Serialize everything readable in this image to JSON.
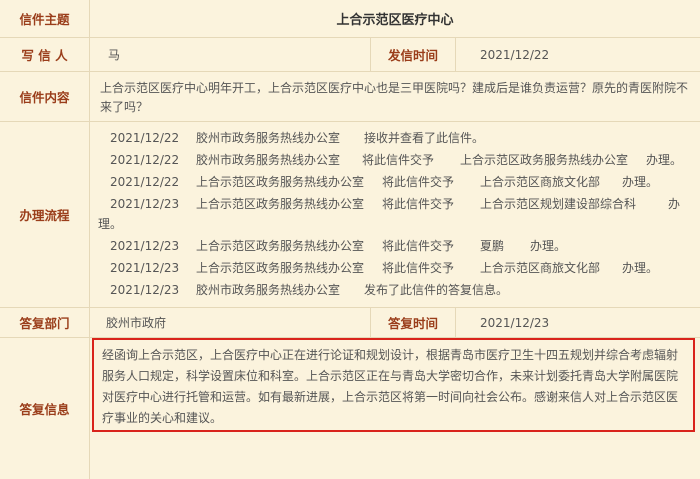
{
  "subject": {
    "label": "信件主题",
    "value": "上合示范区医疗中心"
  },
  "writer": {
    "label": "写 信 人",
    "value": "马",
    "time_label": "发信时间",
    "time_value": "2021/12/22"
  },
  "content": {
    "label": "信件内容",
    "value": "上合示范区医疗中心明年开工，上合示范区医疗中心也是三甲医院吗？建成后是谁负责运营？原先的青医附院不来了吗？"
  },
  "process": {
    "label": "办理流程",
    "steps": [
      {
        "date": "2021/12/22",
        "office": "胶州市政务服务热线办公室",
        "action": "接收并查看了此信件。",
        "target": "",
        "tail": ""
      },
      {
        "date": "2021/12/22",
        "office": "胶州市政务服务热线办公室",
        "action": "将此信件交予",
        "target": "上合示范区政务服务热线办公室",
        "tail": "办理。"
      },
      {
        "date": "2021/12/22",
        "office": "上合示范区政务服务热线办公室",
        "action": "将此信件交予",
        "target": "上合示范区商旅文化部",
        "tail": "办理。"
      },
      {
        "date": "2021/12/23",
        "office": "上合示范区政务服务热线办公室",
        "action": "将此信件交予",
        "target": "上合示范区规划建设部综合科",
        "tail": "办"
      },
      {
        "date": "2021/12/23",
        "office": "上合示范区政务服务热线办公室",
        "action": "将此信件交予",
        "target": "夏鹏",
        "tail": "办理。"
      },
      {
        "date": "2021/12/23",
        "office": "上合示范区政务服务热线办公室",
        "action": "将此信件交予",
        "target": "上合示范区商旅文化部",
        "tail": "办理。"
      },
      {
        "date": "2021/12/23",
        "office": "胶州市政务服务热线办公室",
        "action": "发布了此信件的答复信息。",
        "target": "",
        "tail": ""
      }
    ],
    "continuation": "理。"
  },
  "reply_dept": {
    "label": "答复部门",
    "value": "胶州市政府",
    "time_label": "答复时间",
    "time_value": "2021/12/23"
  },
  "reply": {
    "label": "答复信息",
    "value": "经函询上合示范区，上合医疗中心正在进行论证和规划设计，根据青岛市医疗卫生十四五规划并综合考虑辐射服务人口规定，科学设置床位和科室。上合示范区正在与青岛大学密切合作，未来计划委托青岛大学附属医院对医疗中心进行托管和运营。如有最新进展，上合示范区将第一时间向社会公布。感谢来信人对上合示范区医疗事业的关心和建议。",
    "highlight_color": "#d9231b"
  }
}
